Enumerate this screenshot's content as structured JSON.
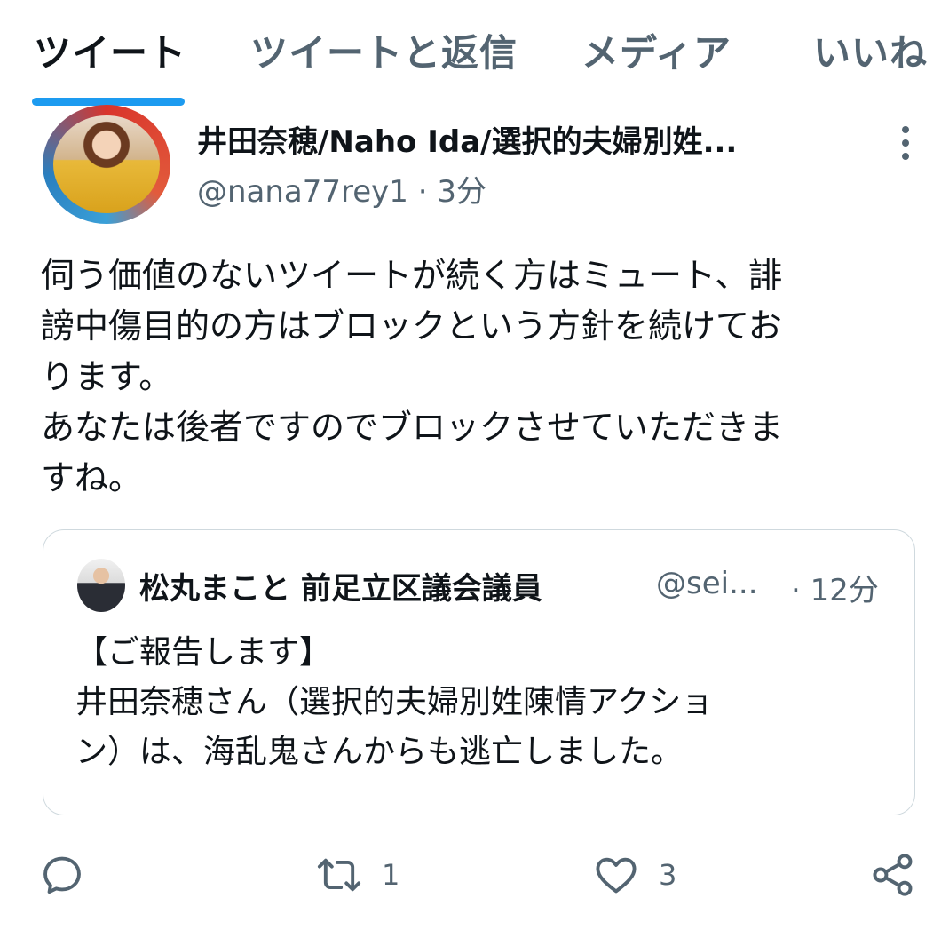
{
  "tabs": [
    {
      "label": "ツイート",
      "active": true
    },
    {
      "label": "ツイートと返信",
      "active": false
    },
    {
      "label": "メディア",
      "active": false
    },
    {
      "label": "いいね",
      "active": false
    }
  ],
  "tweet": {
    "display_name": "井田奈穂/Naho Ida/選択的夫婦別姓...",
    "handle": "@nana77rey1",
    "separator": "·",
    "time": "3分",
    "body": [
      "伺う価値のないツイートが続く方はミュート、誹",
      "謗中傷目的の方はブロックという方針を続けてお",
      "ります。",
      "あなたは後者ですのでブロックさせていただきま",
      "すね。"
    ]
  },
  "quote": {
    "display_name": "松丸まこと 前足立区議会議員",
    "handle": "@sei...",
    "time": "· 12分",
    "body": [
      "【ご報告します】",
      "井田奈穂さん（選択的夫婦別姓陳情アクショ",
      "ン）は、海乱鬼さんからも逃亡しました。"
    ]
  },
  "actions": {
    "reply_icon": "reply-icon",
    "retweet_icon": "retweet-icon",
    "retweet_count": "1",
    "like_icon": "heart-icon",
    "like_count": "3",
    "share_icon": "share-icon"
  },
  "colors": {
    "accent": "#1d9bf0",
    "text_primary": "#0f1419",
    "text_secondary": "#536471",
    "border": "#cfd9de"
  }
}
